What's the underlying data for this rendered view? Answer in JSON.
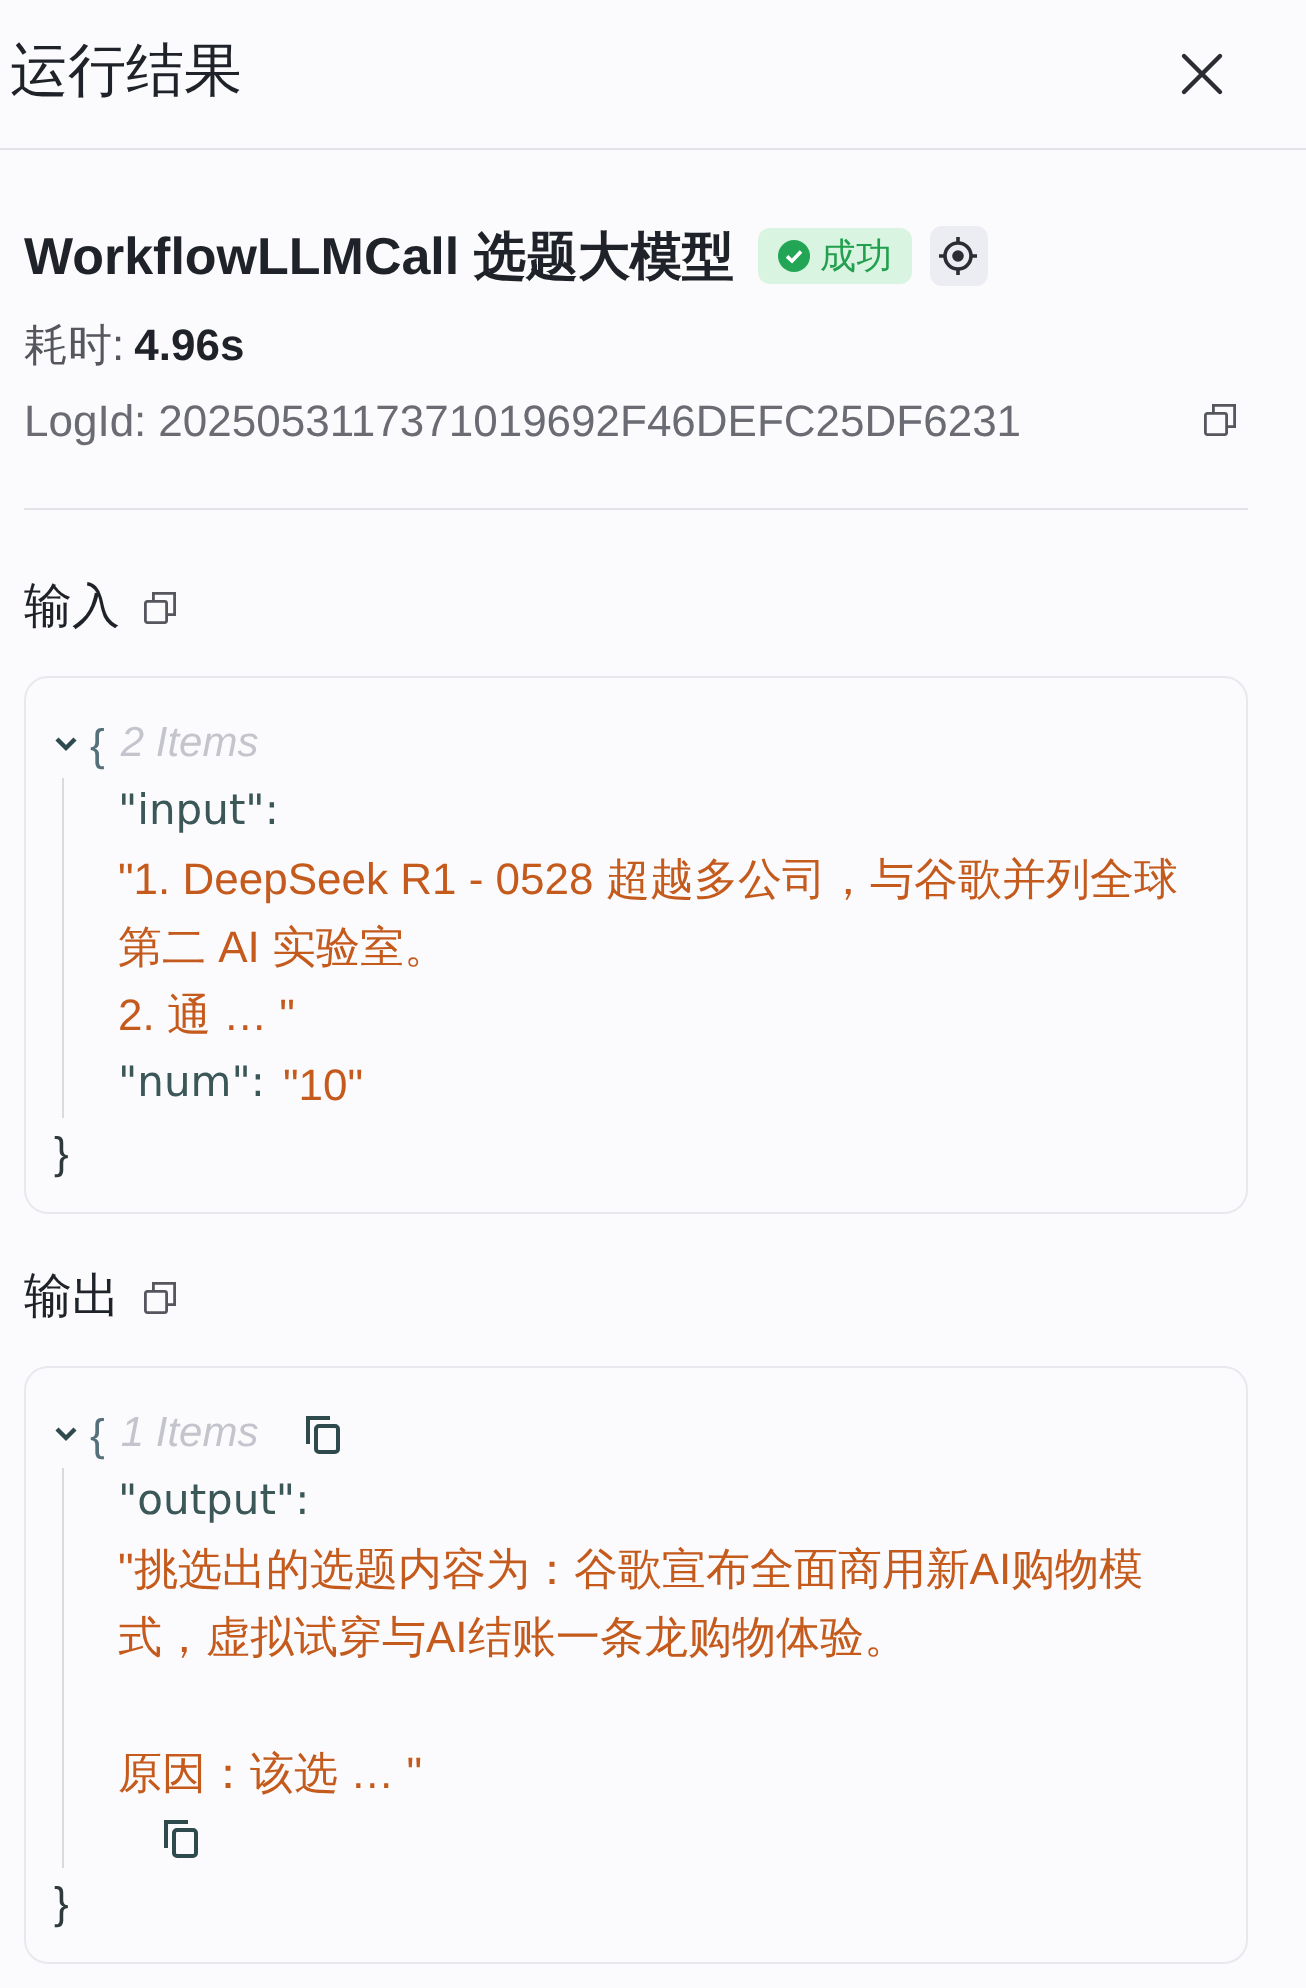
{
  "panel": {
    "title": "运行结果"
  },
  "node": {
    "name": "WorkflowLLMCall 选题大模型",
    "status": {
      "kind": "success",
      "label": "成功"
    },
    "duration": {
      "label": "耗时:",
      "value": "4.96s"
    },
    "log_id": {
      "label": "LogId:",
      "value": "2025053117371019692F46DEFC25DF6231"
    }
  },
  "sections": [
    {
      "title": "输入",
      "viewer": {
        "expanded": true,
        "open": "{",
        "count": "2 Items",
        "copy_button": false,
        "entries": [
          {
            "kind": "block",
            "key": "\"input\":",
            "paragraphs": [
              {
                "text": "\"1. DeepSeek R1 - 0528 超越多公司，与谷歌并列全球第二 AI 实验室。",
                "gap_before": false
              },
              {
                "text": "2. 通 … \"",
                "gap_before": false
              }
            ],
            "copy_button": false
          },
          {
            "kind": "inline",
            "key": "\"num\":",
            "value": "\"10\""
          }
        ],
        "close": "}"
      }
    },
    {
      "title": "输出",
      "viewer": {
        "expanded": true,
        "open": "{",
        "count": "1 Items",
        "copy_button": true,
        "entries": [
          {
            "kind": "block",
            "key": "\"output\":",
            "paragraphs": [
              {
                "text": "\"挑选出的选题内容为：谷歌宣布全面商用新AI购物模式，虚拟试穿与AI结账一条龙购物体验。",
                "gap_before": false
              },
              {
                "text": "原因：该选 … \"",
                "gap_before": true
              }
            ],
            "copy_button": true
          }
        ],
        "close": "}"
      }
    }
  ]
}
